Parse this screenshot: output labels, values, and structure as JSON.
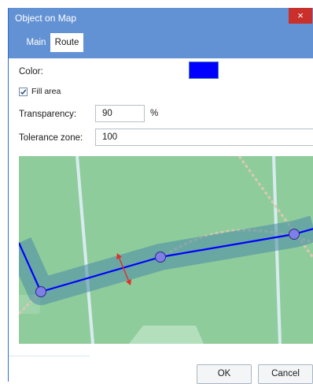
{
  "window": {
    "title": "Object on Map",
    "close_glyph": "×"
  },
  "tabs": [
    {
      "label": "Main"
    },
    {
      "label": "Route"
    }
  ],
  "form": {
    "color_label": "Color:",
    "color_value": "#0000ff",
    "fill_area_label": "Fill area",
    "fill_area_checked": true,
    "transparency_label": "Transparency:",
    "transparency_value": "90",
    "transparency_unit": "%",
    "tolerance_label": "Tolerance zone:",
    "tolerance_value": "100"
  },
  "map": {
    "background": "#8fcc9c",
    "route_color": "#0000ff",
    "zone_color": "#4a8aa8",
    "waypoint_count": 3,
    "resize_handle_color": "#e0302c"
  },
  "buttons": {
    "ok": "OK",
    "cancel": "Cancel"
  }
}
